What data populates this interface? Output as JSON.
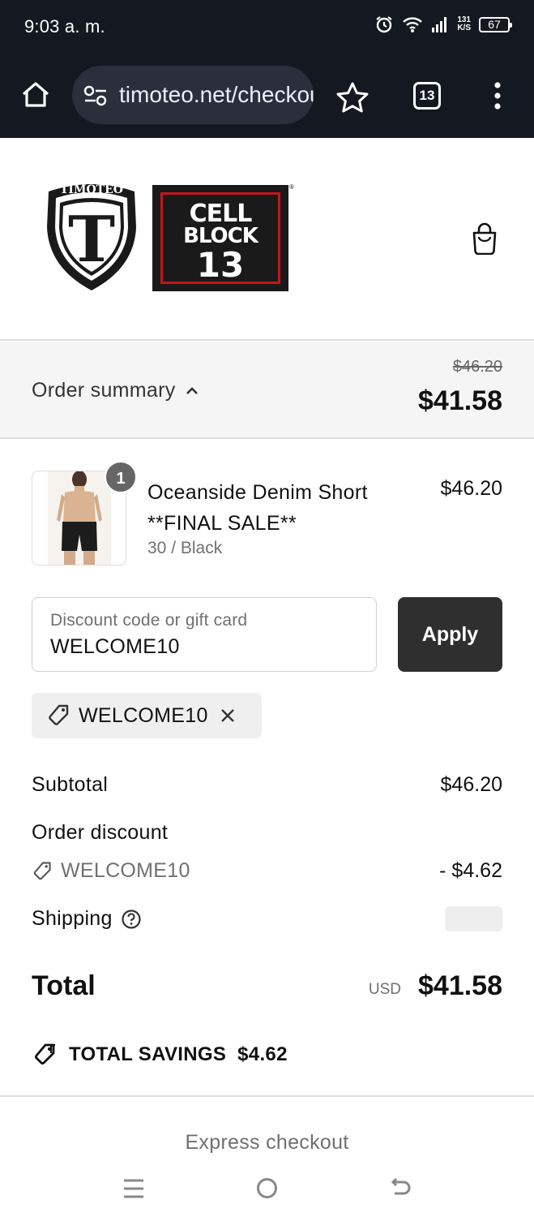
{
  "status_bar": {
    "time": "9:03 a. m.",
    "net_speed_value": "131",
    "net_speed_unit": "K/S",
    "battery": "67"
  },
  "browser": {
    "url": "timoteo.net/checkout",
    "tab_count": "13"
  },
  "store": {
    "logo_shield_text": "TIMOTEO",
    "logo_shield_letter": "T",
    "logo_cellblock_line1": "CELL",
    "logo_cellblock_line2": "BLOCK",
    "logo_cellblock_line3": "13"
  },
  "summary": {
    "toggle_label": "Order summary",
    "original_total": "$46.20",
    "total": "$41.58"
  },
  "product": {
    "quantity": "1",
    "name": "Oceanside Denim Short **FINAL SALE**",
    "variant": "30 / Black",
    "price": "$46.20"
  },
  "discount": {
    "placeholder": "Discount code or gift card",
    "value": "WELCOME10",
    "apply_label": "Apply",
    "applied_code": "WELCOME10"
  },
  "totals": {
    "subtotal_label": "Subtotal",
    "subtotal_value": "$46.20",
    "order_discount_label": "Order discount",
    "discount_code": "WELCOME10",
    "discount_value": "- $4.62",
    "shipping_label": "Shipping",
    "total_label": "Total",
    "currency": "USD",
    "total_value": "$41.58",
    "savings_label": "TOTAL SAVINGS",
    "savings_value": "$4.62"
  },
  "express_checkout_label": "Express checkout",
  "colors": {
    "topbar": "#141820",
    "apply_button": "#2f2f2f",
    "summary_bg": "#f5f5f5",
    "brand_red": "#c4141c"
  }
}
